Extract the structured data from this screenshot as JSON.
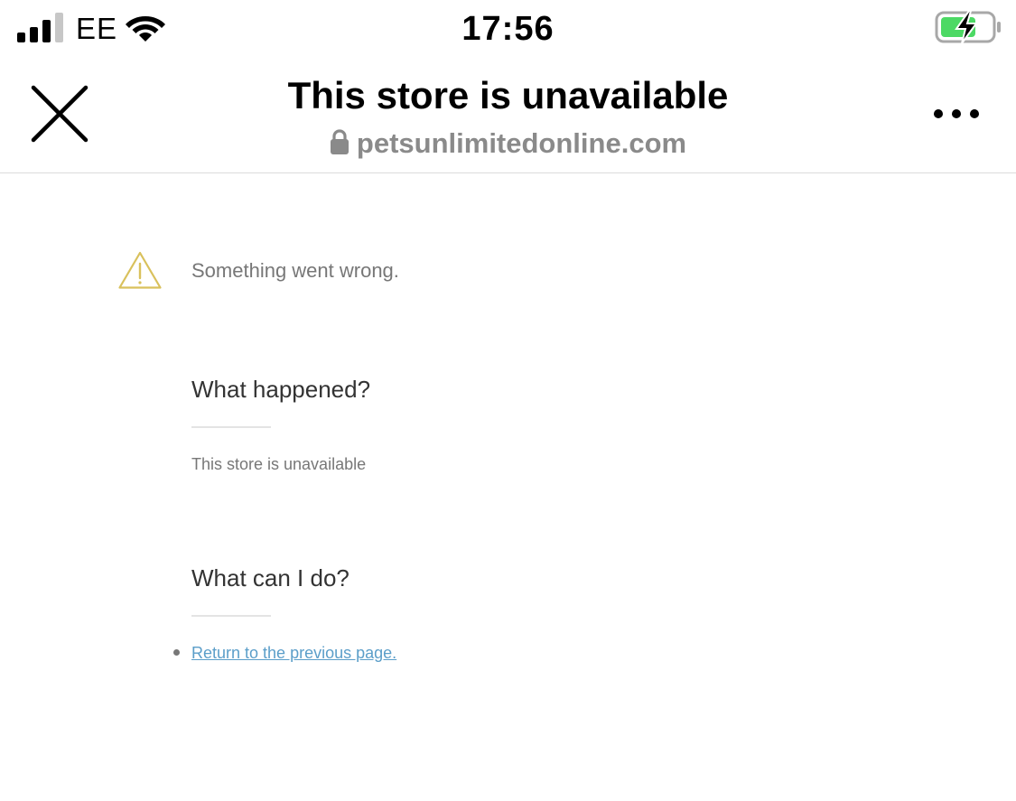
{
  "status_bar": {
    "carrier": "EE",
    "time": "17:56",
    "icons": [
      "signal-icon",
      "wifi-icon",
      "battery-charging-icon"
    ],
    "battery_color": "#4cd964"
  },
  "header": {
    "title": "This store is unavailable",
    "url": "petsunlimitedonline.com",
    "icons": [
      "close-icon",
      "lock-icon",
      "more-icon"
    ]
  },
  "error": {
    "icon": "warning-icon",
    "icon_color": "#d9c15c",
    "message": "Something went wrong."
  },
  "sections": {
    "what_happened": {
      "heading": "What happened?",
      "text": "This store is unavailable"
    },
    "what_can_i_do": {
      "heading": "What can I do?",
      "link_text": "Return to the previous page.",
      "link_color": "#5b9ec9"
    }
  }
}
